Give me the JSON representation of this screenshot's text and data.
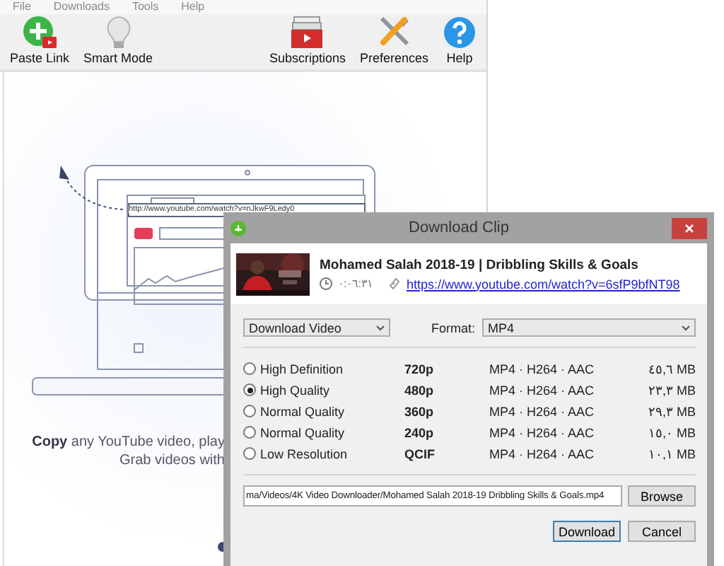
{
  "menu": [
    "File",
    "Downloads",
    "Tools",
    "Help"
  ],
  "toolbar": {
    "left": [
      {
        "kind": "paste",
        "label": "Paste Link"
      },
      {
        "kind": "bulb",
        "label": "Smart Mode"
      }
    ],
    "right": [
      {
        "kind": "subs",
        "label": "Subscriptions"
      },
      {
        "kind": "prefs",
        "label": "Preferences"
      },
      {
        "kind": "help",
        "label": "Help"
      }
    ]
  },
  "illustration": {
    "url": "http://www.youtube.com/watch?v=nJkwF9Ledy0"
  },
  "caption": [
    "**Copy** any YouTube video, play",
    "Grab videos with"
  ],
  "dialog": {
    "title": "Download Clip",
    "video": {
      "kind": "picture",
      "title": "Mohamed Salah 2018-19 | Dribbling Skills & Goals",
      "duration": "٠:٠٦:٣١",
      "url": "https://www.youtube.com/watch?v=6sfP9bfNT98"
    },
    "mode": "Download Video",
    "format_label": "Format:",
    "format": "MP4",
    "qualities": [
      {
        "name": "High Definition",
        "resolution": "720p",
        "codec": "MP4 · H264 · AAC",
        "size": "٤٥,٦ MB",
        "selected": false
      },
      {
        "name": "High Quality",
        "resolution": "480p",
        "codec": "MP4 · H264 · AAC",
        "size": "٢٣,٣ MB",
        "selected": true
      },
      {
        "name": "Normal Quality",
        "resolution": "360p",
        "codec": "MP4 · H264 · AAC",
        "size": "٢٩,٣ MB",
        "selected": false
      },
      {
        "name": "Normal Quality",
        "resolution": "240p",
        "codec": "MP4 · H264 · AAC",
        "size": "١٥,٠ MB",
        "selected": false
      },
      {
        "name": "Low Resolution",
        "resolution": "QCIF",
        "codec": "MP4 · H264 · AAC",
        "size": "١٠,١ MB",
        "selected": false
      }
    ],
    "path": "ma/Videos/4K Video Downloader/Mohamed Salah 2018-19 Dribbling Skills & Goals.mp4",
    "buttons": {
      "browse": "Browse",
      "download": "Download",
      "cancel": "Cancel"
    }
  }
}
